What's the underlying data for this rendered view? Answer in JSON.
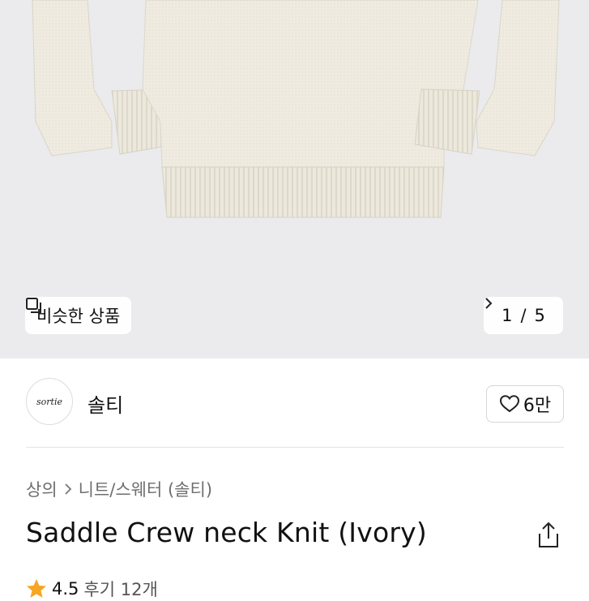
{
  "gallery": {
    "image_alt": "ivory crew neck knit sweater",
    "similar_label": "비슷한 상품",
    "counter_current": "1",
    "counter_separator": "/",
    "counter_total": "5"
  },
  "brand": {
    "logo_text": "sortie",
    "name": "솔티",
    "like_count": "6만"
  },
  "breadcrumb": {
    "items": [
      "상의",
      "니트/스웨터 (솔티)"
    ]
  },
  "product": {
    "title": "Saddle Crew neck Knit (Ivory)"
  },
  "rating": {
    "score": "4.5",
    "reviews": "후기 12개"
  },
  "colors": {
    "hero_bg": "#ebebed",
    "sweater": "#ece8dc",
    "star": "#f5a623"
  }
}
